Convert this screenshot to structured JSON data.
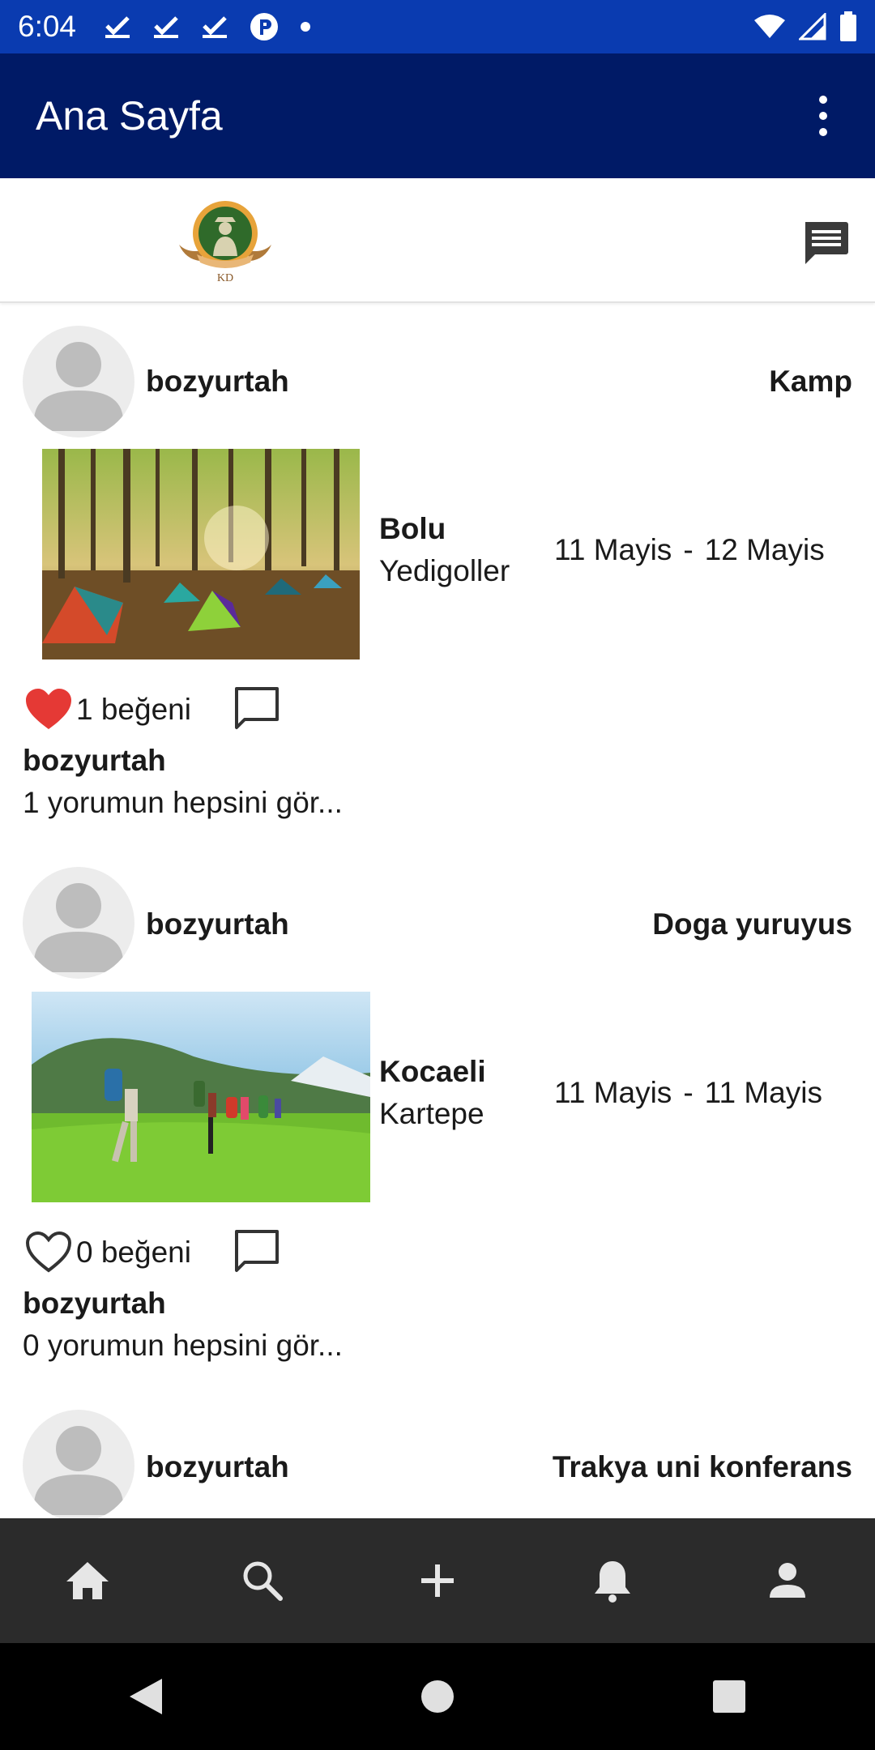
{
  "status_bar": {
    "time": "6:04",
    "icons_left": [
      "check-icon",
      "check-icon",
      "check-icon",
      "p-circle-icon",
      "dot-icon"
    ],
    "icons_right": [
      "wifi-icon",
      "signal-icon",
      "battery-icon"
    ]
  },
  "app_bar": {
    "title": "Ana Sayfa",
    "menu_icon": "overflow-menu-icon"
  },
  "top_strip": {
    "logo_text": "KD",
    "messages_icon": "messages-icon"
  },
  "posts": [
    {
      "username": "bozyurtah",
      "category": "Kamp",
      "city": "Bolu",
      "district": "Yedigoller",
      "start_date": "11 Mayis",
      "separator": "-",
      "end_date": "12 Mayis",
      "like_count": "1 beğeni",
      "liked": true,
      "author": "bozyurtah",
      "comments_link": "1 yorumun hepsini gör..."
    },
    {
      "username": "bozyurtah",
      "category": "Doga yuruyus",
      "city": "Kocaeli",
      "district": "Kartepe",
      "start_date": "11 Mayis",
      "separator": "-",
      "end_date": "11 Mayis",
      "like_count": "0 beğeni",
      "liked": false,
      "author": "bozyurtah",
      "comments_link": "0 yorumun hepsini gör..."
    },
    {
      "username": "bozyurtah",
      "category": "Trakya uni konferans"
    }
  ],
  "bottom_nav": [
    "home-icon",
    "search-icon",
    "add-icon",
    "notifications-icon",
    "profile-icon"
  ],
  "system_nav": [
    "back-icon",
    "home-circle-icon",
    "recents-icon"
  ],
  "colors": {
    "status_bar": "#0a3bb0",
    "app_bar": "#001a66",
    "bottom_nav": "#2b2b2b",
    "like_active": "#e53935"
  }
}
